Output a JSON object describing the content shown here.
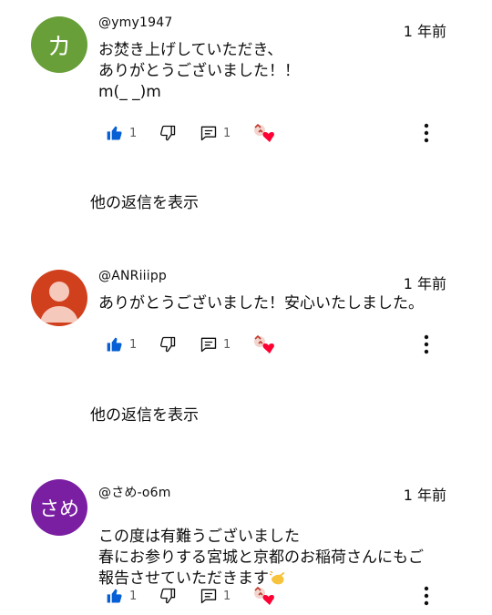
{
  "comments": [
    {
      "avatar_letter": "カ",
      "avatar_color": "#689f38",
      "handle": "@ymy1947",
      "time": "1 年前",
      "text": "お焚き上げしていただき、\nありがとうございました！！\nm(_ _)m",
      "likes": "1",
      "replies_count": "1"
    },
    {
      "avatar_letter": "",
      "avatar_color": "#d1401d",
      "handle": "@ANRiiipp",
      "time": "1 年前",
      "text": "ありがとうございました！安心いたしました。",
      "likes": "1",
      "replies_count": "1"
    },
    {
      "avatar_letter": "さめ",
      "avatar_color": "#7b1fa2",
      "handle": "@さめ-o6m",
      "time": "1 年前",
      "text": "この度は有難うございました\n春にお参りする宮城と京都のお稲荷さんにもご\n報告させていただきます",
      "likes": "1",
      "replies_count": "1"
    }
  ],
  "show_replies_label": "他の返信を表示",
  "icons": {
    "like": "thumbs-up-icon",
    "dislike": "thumbs-down-icon",
    "reply": "comment-icon",
    "creator_heart": "creator-heart-icon",
    "more": "more-vert-icon"
  },
  "colors": {
    "like_blue": "#065fd4",
    "heart_red": "#ff0033",
    "muted": "#606060"
  }
}
